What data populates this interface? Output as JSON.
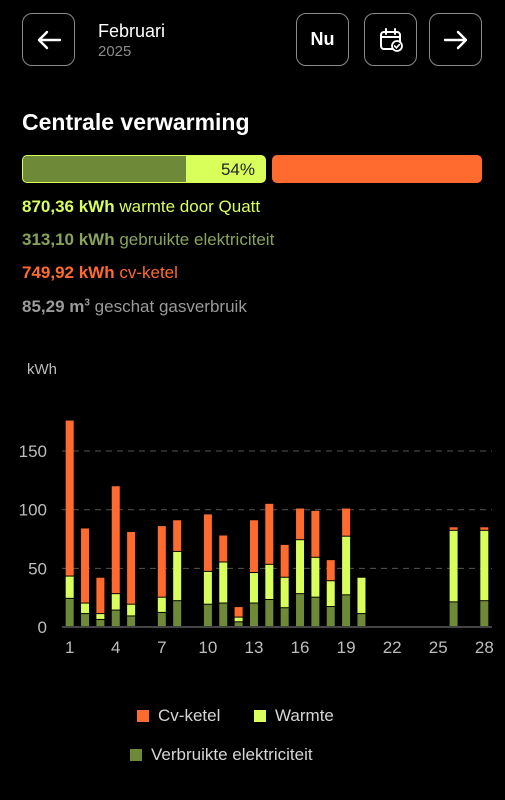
{
  "header": {
    "month": "Februari",
    "year": "2025",
    "now_label": "Nu",
    "back_icon": "arrow-left-icon",
    "calendar_icon": "calendar-check-icon",
    "next_icon": "arrow-right-icon"
  },
  "section": {
    "title": "Centrale verwarming",
    "ratio_percent_label": "54%",
    "electric_share_fraction": 0.36,
    "heat_share_fraction": 0.54
  },
  "stats": {
    "heat": {
      "value": "870,36 kWh",
      "label": " warmte door Quatt"
    },
    "electricity": {
      "value": "313,10 kWh",
      "label": " gebruikte elektriciteit"
    },
    "boiler": {
      "value": "749,92 kWh",
      "label": " cv-ketel"
    },
    "gas": {
      "value": "85,29 m",
      "unit_sup": "3",
      "label": " geschat gasverbruik"
    }
  },
  "colors": {
    "heat": "#d9ff5a",
    "electricity": "#6e8a38",
    "boiler": "#ff6b2e",
    "grid": "#555555",
    "axis_text": "#bdbdbd"
  },
  "chart_data": {
    "type": "bar",
    "stacked": true,
    "ylabel": "kWh",
    "ylim": [
      0,
      185
    ],
    "yticks": [
      0,
      50,
      100,
      150
    ],
    "x": [
      1,
      2,
      3,
      4,
      5,
      6,
      7,
      8,
      9,
      10,
      11,
      12,
      13,
      14,
      15,
      16,
      17,
      18,
      19,
      20,
      21,
      22,
      23,
      24,
      25,
      26,
      27,
      28
    ],
    "xticks": [
      1,
      4,
      7,
      10,
      13,
      16,
      19,
      22,
      25,
      28
    ],
    "grid": true,
    "legend_position": "bottom",
    "series": [
      {
        "name": "Verbruikte elektriciteit",
        "values": [
          24,
          11,
          6,
          14,
          9,
          0,
          12,
          22,
          0,
          19,
          20,
          4,
          20,
          23,
          16,
          28,
          25,
          17,
          27,
          11,
          0,
          0,
          0,
          0,
          0,
          21,
          0,
          22
        ]
      },
      {
        "name": "Warmte",
        "values": [
          19,
          9,
          5,
          14,
          10,
          0,
          13,
          42,
          0,
          28,
          35,
          4,
          26,
          30,
          26,
          46,
          34,
          22,
          50,
          31,
          0,
          0,
          0,
          0,
          0,
          61,
          0,
          60
        ]
      },
      {
        "name": "Cv-ketel",
        "values": [
          133,
          64,
          31,
          92,
          62,
          0,
          61,
          27,
          0,
          49,
          23,
          9,
          45,
          52,
          28,
          27,
          40,
          18,
          24,
          0,
          0,
          0,
          0,
          0,
          0,
          3,
          0,
          3
        ]
      }
    ]
  },
  "legend": {
    "cv": "Cv-ketel",
    "warm": "Warmte",
    "elec": "Verbruikte elektriciteit"
  }
}
